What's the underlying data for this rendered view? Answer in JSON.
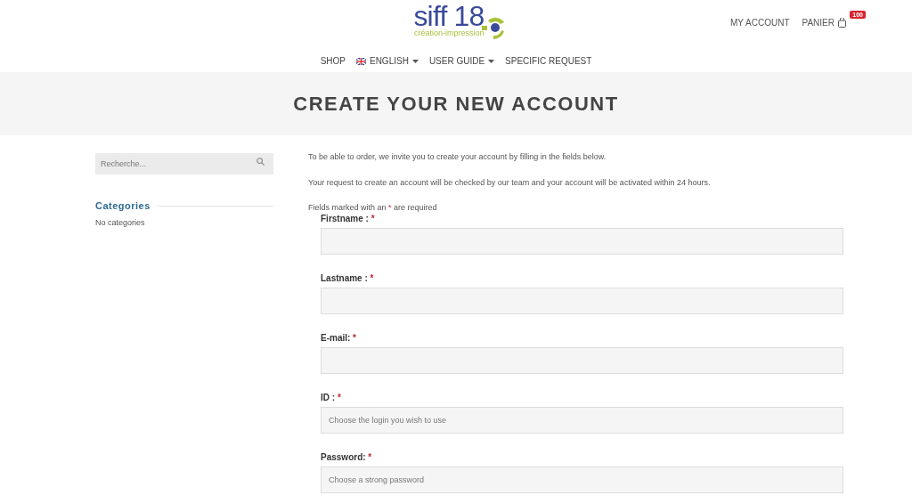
{
  "logo": {
    "name": "siff 18",
    "tagline": "création-impression"
  },
  "account_links": {
    "account": "MY ACCOUNT",
    "cart": "PANIER",
    "cart_count": "100"
  },
  "nav": [
    {
      "label": "SHOP",
      "dropdown": false,
      "flag": false
    },
    {
      "label": "ENGLISH",
      "dropdown": true,
      "flag": true
    },
    {
      "label": "USER GUIDE",
      "dropdown": true,
      "flag": false
    },
    {
      "label": "SPECIFIC REQUEST",
      "dropdown": false,
      "flag": false
    }
  ],
  "page_title": "CREATE YOUR NEW ACCOUNT",
  "sidebar": {
    "search": {
      "placeholder": "Recherche..."
    },
    "categories_title": "Categories",
    "categories_empty": "No categories"
  },
  "intro": [
    "To be able to order, we invite you to create your account by filling in the fields below.",
    "Your request to create an account will be checked by our team and your account will be activated within 24 hours."
  ],
  "required_note": {
    "before": "Fields marked with an",
    "mark": "*",
    "after": "are required"
  },
  "fields": [
    {
      "label": "Firstname :",
      "required": true
    },
    {
      "label": "Lastname :",
      "required": true
    },
    {
      "label": "E-mail:",
      "required": true
    },
    {
      "label": "ID :",
      "required": true,
      "placeholder": "Choose the login you wish to use"
    },
    {
      "label": "Password:",
      "required": true,
      "placeholder": "Choose a strong password"
    }
  ]
}
